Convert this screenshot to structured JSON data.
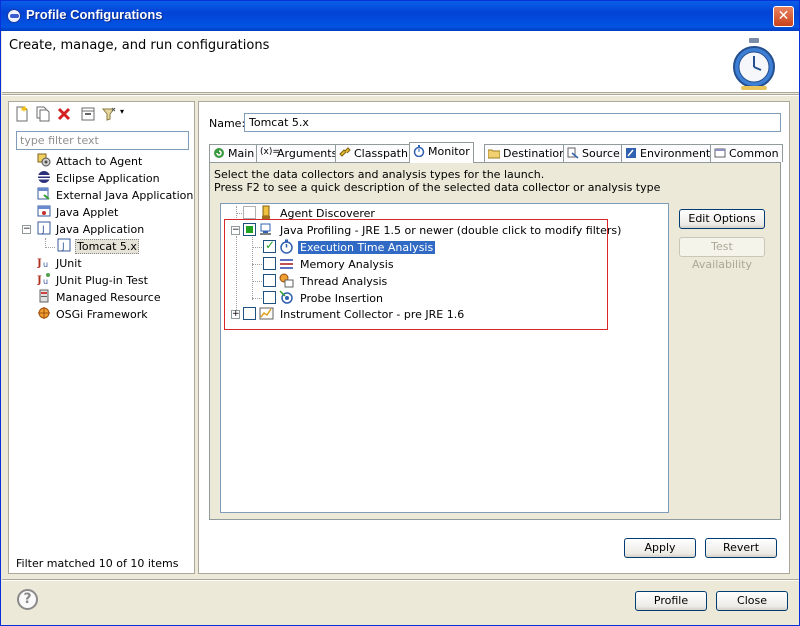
{
  "window": {
    "title": "Profile Configurations"
  },
  "header": {
    "subtitle": "Create, manage, and run configurations"
  },
  "left": {
    "filter_placeholder": "type filter text",
    "status": "Filter matched 10 of 10 items",
    "tree": [
      {
        "label": "Attach to Agent",
        "icon": "attach-agent-icon"
      },
      {
        "label": "Eclipse Application",
        "icon": "eclipse-icon"
      },
      {
        "label": "External Java Application",
        "icon": "external-java-icon"
      },
      {
        "label": "Java Applet",
        "icon": "java-applet-icon"
      },
      {
        "label": "Java Application",
        "icon": "java-app-icon",
        "expanded": true
      },
      {
        "label": "Tomcat 5.x",
        "icon": "java-app-icon",
        "selected": true
      },
      {
        "label": "JUnit",
        "icon": "junit-icon"
      },
      {
        "label": "JUnit Plug-in Test",
        "icon": "junit-plugin-icon"
      },
      {
        "label": "Managed Resource",
        "icon": "managed-resource-icon"
      },
      {
        "label": "OSGi Framework",
        "icon": "osgi-icon"
      }
    ],
    "toolbar": [
      "new-config-icon",
      "duplicate-icon",
      "delete-icon",
      "collapse-all-icon",
      "filter-icon"
    ]
  },
  "right": {
    "name_label": "Name:",
    "name_value": "Tomcat 5.x",
    "tabs": [
      {
        "label": "Main"
      },
      {
        "label": "Arguments"
      },
      {
        "label": "Classpath"
      },
      {
        "label": "Monitor",
        "active": true
      },
      {
        "label": "Destination"
      },
      {
        "label": "Source"
      },
      {
        "label": "Environment"
      },
      {
        "label": "Common"
      }
    ],
    "desc_line1": "Select the data collectors and analysis types for the launch.",
    "desc_line2": "Press F2 to see a quick description of the selected data collector or analysis type",
    "collectors": [
      {
        "label": "Agent Discoverer",
        "checked": false
      },
      {
        "label": "Java Profiling - JRE 1.5 or newer (double click to modify filters)",
        "state": "partial",
        "expanded": true
      },
      {
        "label": "Execution Time Analysis",
        "checked": true,
        "selected": true
      },
      {
        "label": "Memory Analysis",
        "checked": false
      },
      {
        "label": "Thread Analysis",
        "checked": false
      },
      {
        "label": "Probe Insertion",
        "checked": false
      },
      {
        "label": "Instrument Collector - pre JRE 1.6",
        "checked": false,
        "collapsed": true
      }
    ],
    "edit_options": "Edit Options",
    "test_availability": "Test Availability",
    "apply": "Apply",
    "revert": "Revert"
  },
  "footer": {
    "profile": "Profile",
    "close": "Close"
  }
}
